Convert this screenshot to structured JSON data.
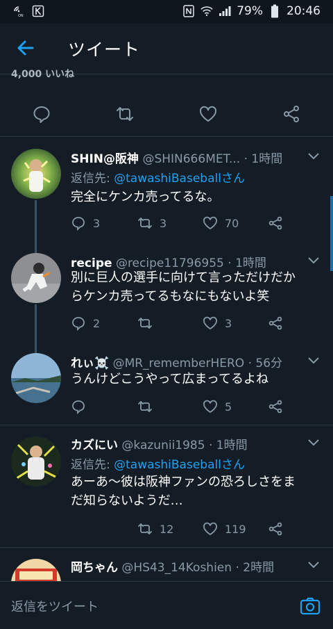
{
  "status_bar": {
    "battery": "79%",
    "time": "20:46",
    "icons": [
      "wifi-calling-icon",
      "app-k-icon",
      "nfc-icon",
      "wifi-icon",
      "signal-icon",
      "battery-icon"
    ]
  },
  "header": {
    "title": "ツイート",
    "back_icon": "arrow-left-icon"
  },
  "prev_tweet": {
    "like_count_snippet": "4,000 いいね"
  },
  "tweets": [
    {
      "name": "SHIN@阪神",
      "handle": "@SHIN666MET...",
      "time": "· 1時間",
      "reply_prefix": "返信先: ",
      "reply_to": "@tawashiBaseballさん",
      "text": "完全にケンカ売ってるな。",
      "replies": "3",
      "retweets": "3",
      "likes": "70"
    },
    {
      "name": "recipe",
      "handle": "@recipe11796955",
      "time": "· 1時間",
      "text_line1": "別に巨人の選手に向けて言っただけだか",
      "text_line2": "らケンカ売ってるもなにもないよ笑",
      "replies": "2",
      "retweets": "",
      "likes": "3"
    },
    {
      "name": "れぃ☠️",
      "handle": "@MR_rememberHERO",
      "time": "· 56分",
      "text": "うんけどこうやって広まってるよね",
      "replies": "",
      "retweets": "",
      "likes": "5"
    },
    {
      "name": "カズにい",
      "handle": "@kazunii1985",
      "time": "· 1時間",
      "reply_prefix": "返信先: ",
      "reply_to": "@tawashiBaseballさん",
      "text_line1": "あーあ〜彼は阪神ファンの恐ろしさをま",
      "text_line2": "だ知らないようだ…",
      "replies": "",
      "retweets": "12",
      "likes": "119"
    },
    {
      "name": "岡ちゃん",
      "handle": "@HS43_14Koshien",
      "time": "· 2時間"
    }
  ],
  "reply_bar": {
    "placeholder": "返信をツイート",
    "camera_icon": "camera-icon"
  },
  "colors": {
    "background": "#141d26",
    "accent": "#1da1f2",
    "muted": "#8899a6",
    "divider": "#2b3a48"
  }
}
